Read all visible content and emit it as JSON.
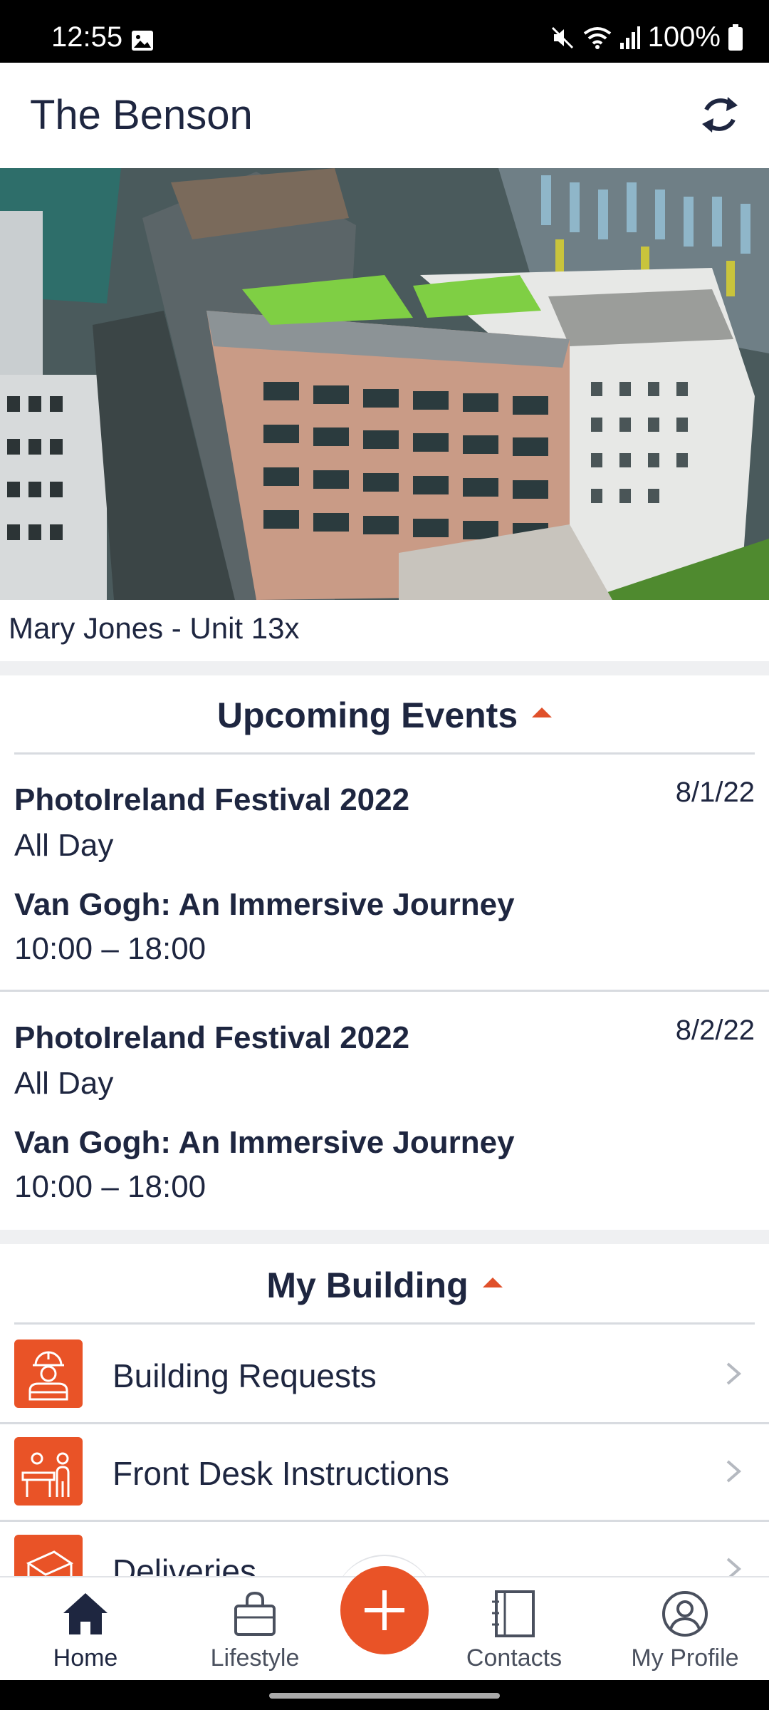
{
  "status_bar": {
    "time": "12:55",
    "battery_percent": "100%",
    "icons": [
      "image-icon",
      "mute-icon",
      "wifi-icon",
      "signal-icon",
      "battery-icon"
    ]
  },
  "header": {
    "title": "The Benson",
    "refresh_icon": "refresh-icon"
  },
  "resident": {
    "label": "Mary Jones - Unit 13x"
  },
  "upcoming_events": {
    "heading": "Upcoming Events",
    "days": [
      {
        "date": "8/1/22",
        "events": [
          {
            "title": "PhotoIreland Festival 2022",
            "time": "All Day"
          },
          {
            "title": "Van Gogh: An Immersive Journey",
            "time": "10:00 – 18:00"
          }
        ]
      },
      {
        "date": "8/2/22",
        "events": [
          {
            "title": "PhotoIreland Festival 2022",
            "time": "All Day"
          },
          {
            "title": "Van Gogh: An Immersive Journey",
            "time": "10:00 – 18:00"
          }
        ]
      }
    ]
  },
  "my_building": {
    "heading": "My Building",
    "items": [
      {
        "label": "Building Requests",
        "icon": "worker-icon"
      },
      {
        "label": "Front Desk Instructions",
        "icon": "front-desk-icon"
      },
      {
        "label": "Deliveries",
        "icon": "delivery-icon"
      }
    ]
  },
  "bottom_nav": {
    "items": [
      {
        "label": "Home",
        "icon": "home-icon",
        "active": true
      },
      {
        "label": "Lifestyle",
        "icon": "shopping-bag-icon",
        "active": false
      },
      {
        "label": "Contacts",
        "icon": "contacts-book-icon",
        "active": false
      },
      {
        "label": "My Profile",
        "icon": "profile-icon",
        "active": false
      }
    ],
    "fab_icon": "plus-icon"
  },
  "colors": {
    "accent": "#e95327",
    "text_dark": "#1e2640",
    "divider": "#d8dbe0"
  }
}
